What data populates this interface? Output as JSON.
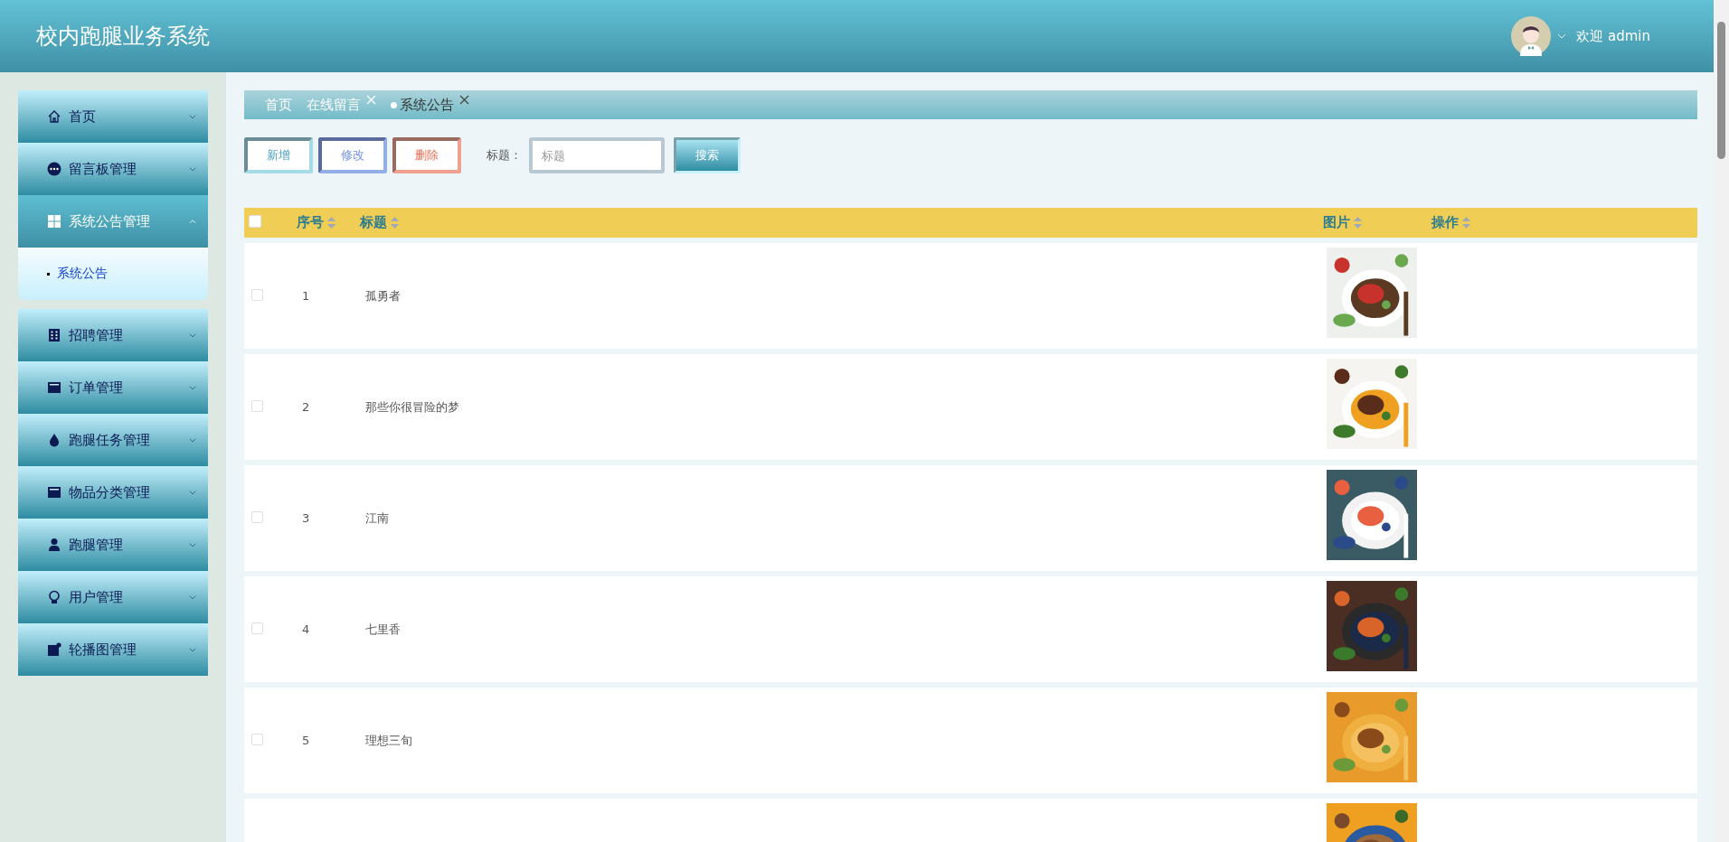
{
  "header": {
    "title": "校内跑腿业务系统",
    "greeting": "欢迎 admin"
  },
  "sidebar": {
    "items": [
      {
        "label": "首页",
        "expanded": false
      },
      {
        "label": "留言板管理",
        "expanded": false
      },
      {
        "label": "系统公告管理",
        "expanded": true,
        "children": [
          {
            "label": "系统公告",
            "selected": true
          }
        ]
      },
      {
        "label": "招聘管理",
        "expanded": false
      },
      {
        "label": "订单管理",
        "expanded": false
      },
      {
        "label": "跑腿任务管理",
        "expanded": false
      },
      {
        "label": "物品分类管理",
        "expanded": false
      },
      {
        "label": "跑腿管理",
        "expanded": false
      },
      {
        "label": "用户管理",
        "expanded": false
      },
      {
        "label": "轮播图管理",
        "expanded": false
      }
    ]
  },
  "breadcrumb": {
    "tabs": [
      {
        "label": "首页",
        "closable": false,
        "selected": false
      },
      {
        "label": "在线留言",
        "closable": true,
        "selected": false
      },
      {
        "label": "系统公告",
        "closable": true,
        "selected": true
      }
    ]
  },
  "toolbar": {
    "buttons": [
      {
        "label": "新增",
        "kind": "add"
      },
      {
        "label": "修改",
        "kind": "edit"
      },
      {
        "label": "删除",
        "kind": "delete"
      }
    ],
    "search": {
      "label": "标题：",
      "placeholder": "标题",
      "button": "搜索"
    }
  },
  "table": {
    "select_all_checked": false,
    "columns": [
      {
        "label": "序号"
      },
      {
        "label": "标题"
      },
      {
        "label": "图片"
      },
      {
        "label": "操作"
      }
    ],
    "rows": [
      {
        "checked": false,
        "index": "1",
        "title": "孤勇者",
        "image": {
          "kind": "picture"
        }
      },
      {
        "checked": false,
        "index": "2",
        "title": "那些你很冒险的梦",
        "image": {
          "kind": "picture"
        }
      },
      {
        "checked": false,
        "index": "3",
        "title": "江南",
        "image": {
          "kind": "picture"
        }
      },
      {
        "checked": false,
        "index": "4",
        "title": "七里香",
        "image": {
          "kind": "picture"
        }
      },
      {
        "checked": false,
        "index": "5",
        "title": "理想三旬",
        "image": {
          "kind": "picture"
        }
      },
      {
        "image": {
          "kind": "picture"
        }
      }
    ]
  }
}
